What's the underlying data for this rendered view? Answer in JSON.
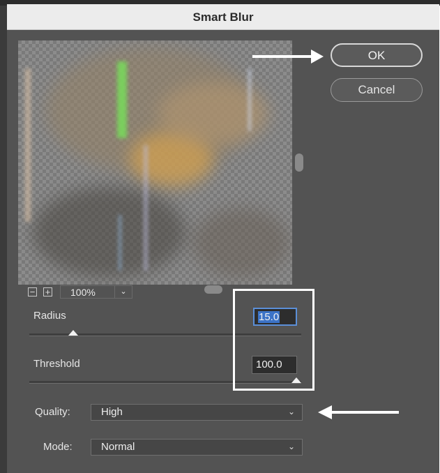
{
  "dialog": {
    "title": "Smart Blur"
  },
  "buttons": {
    "ok": "OK",
    "cancel": "Cancel"
  },
  "preview": {
    "zoom_out": "−",
    "zoom_in": "+",
    "zoom": "100%"
  },
  "radius": {
    "label": "Radius",
    "value": "15.0",
    "slider_fraction": 0.15
  },
  "threshold": {
    "label": "Threshold",
    "value": "100.0",
    "slider_fraction": 1.0
  },
  "quality": {
    "label": "Quality:",
    "value": "High"
  },
  "mode": {
    "label": "Mode:",
    "value": "Normal"
  },
  "icons": {
    "dropdown": "chevron-down-icon",
    "arrow": "arrow-left-icon"
  },
  "colors": {
    "dialog_bg": "#535353",
    "accent": "#3c73c7",
    "annotation": "#ffffff"
  }
}
